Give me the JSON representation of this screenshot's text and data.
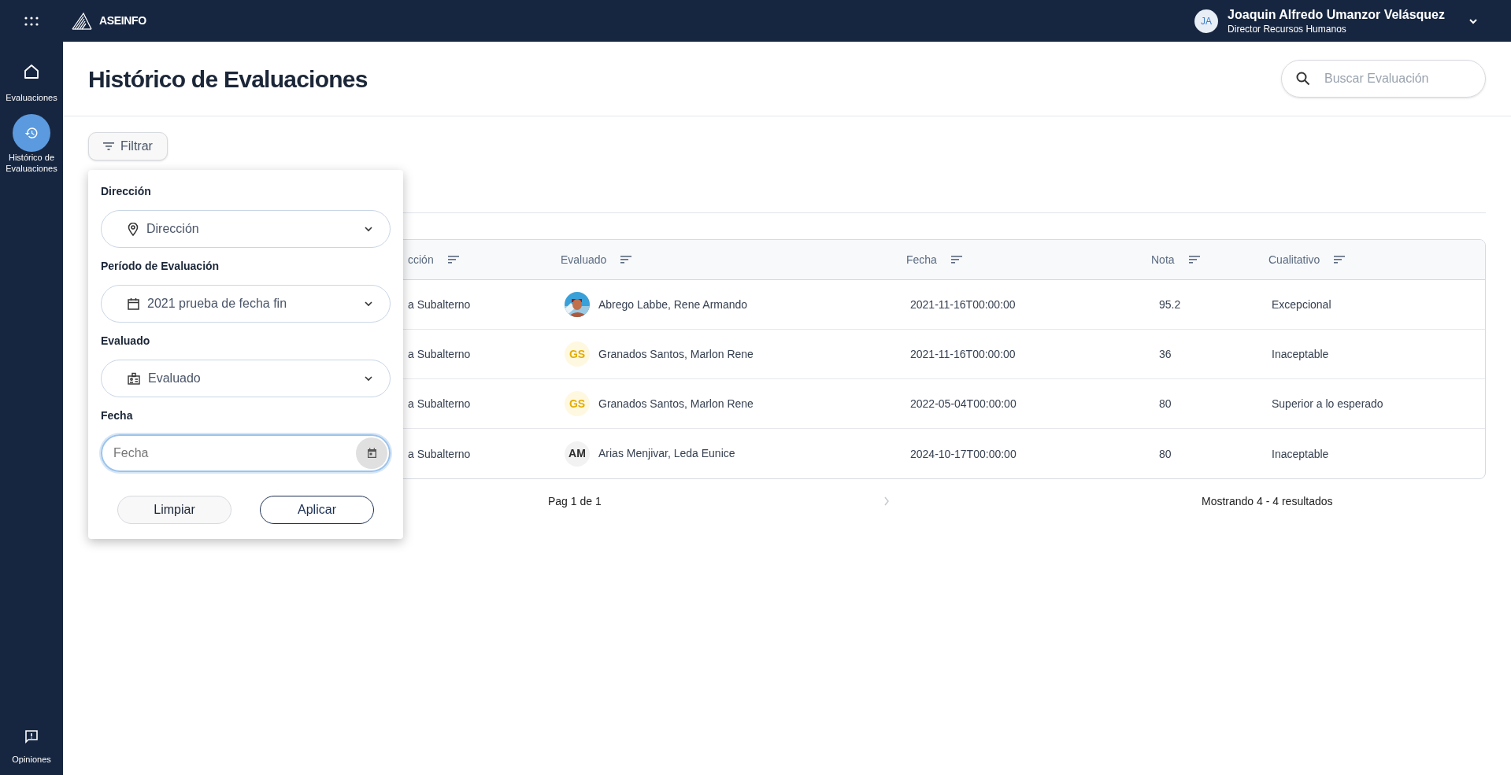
{
  "app_bar": {
    "logo": "ASEINFO",
    "user": {
      "initials": "JA",
      "name": "Joaquin Alfredo Umanzor Velásquez",
      "role": "Director Recursos Humanos"
    }
  },
  "sidebar": {
    "items": [
      {
        "label": "Evaluaciones",
        "selected": false
      },
      {
        "label": "Histórico de Evaluaciones",
        "selected": true
      }
    ],
    "footer_item": {
      "label": "Opiniones"
    }
  },
  "page": {
    "title": "Histórico de Evaluaciones",
    "search": {
      "placeholder": "Buscar Evaluación"
    },
    "filter_button": "Filtrar"
  },
  "filter_panel": {
    "fields": [
      {
        "kind": "select",
        "label": "Dirección",
        "value": "Dirección"
      },
      {
        "kind": "select",
        "label": "Período de Evaluación",
        "value": "2021 prueba de fecha fin"
      },
      {
        "kind": "select",
        "label": "Evaluado",
        "value": "Evaluado"
      },
      {
        "kind": "date",
        "label": "Fecha",
        "placeholder": "Fecha"
      }
    ],
    "buttons": [
      {
        "label": "Limpiar",
        "kind": "secondary"
      },
      {
        "label": "Aplicar",
        "kind": "primary"
      }
    ]
  },
  "table": {
    "columns": [
      "cción",
      "Evaluado",
      "Fecha",
      "Nota",
      "Cualitativo"
    ],
    "rows": [
      {
        "direccion": "a Subalterno",
        "evaluado": {
          "name": "Abrego Labbe, Rene Armando"
        },
        "fecha": "2021-11-16T00:00:00",
        "nota": "95.2",
        "cualitativo": "Excepcional"
      },
      {
        "direccion": "a Subalterno",
        "evaluado": {
          "avatar": {
            "kind": "initials",
            "text": "GS",
            "color": "#e3ac00"
          },
          "name": "Granados Santos, Marlon Rene"
        },
        "fecha": "2021-11-16T00:00:00",
        "nota": "36",
        "cualitativo": "Inaceptable"
      },
      {
        "direccion": "a Subalterno",
        "evaluado": {
          "avatar": {
            "kind": "initials",
            "text": "GS",
            "color": "#e3ac00"
          },
          "name": "Granados Santos, Marlon Rene"
        },
        "fecha": "2022-05-04T00:00:00",
        "nota": "80",
        "cualitativo": "Superior a lo esperado"
      },
      {
        "direccion": "a Subalterno",
        "evaluado": {
          "avatar": {
            "kind": "initials",
            "text": "AM",
            "color": "#2b2b2b"
          },
          "name": "Arias Menjivar, Leda Eunice"
        },
        "fecha": "2024-10-17T00:00:00",
        "nota": "80",
        "cualitativo": "Inaceptable"
      }
    ]
  },
  "pagination": {
    "page": "Pag 1 de 1",
    "summary": "Mostrando 4 - 4 resultados"
  }
}
